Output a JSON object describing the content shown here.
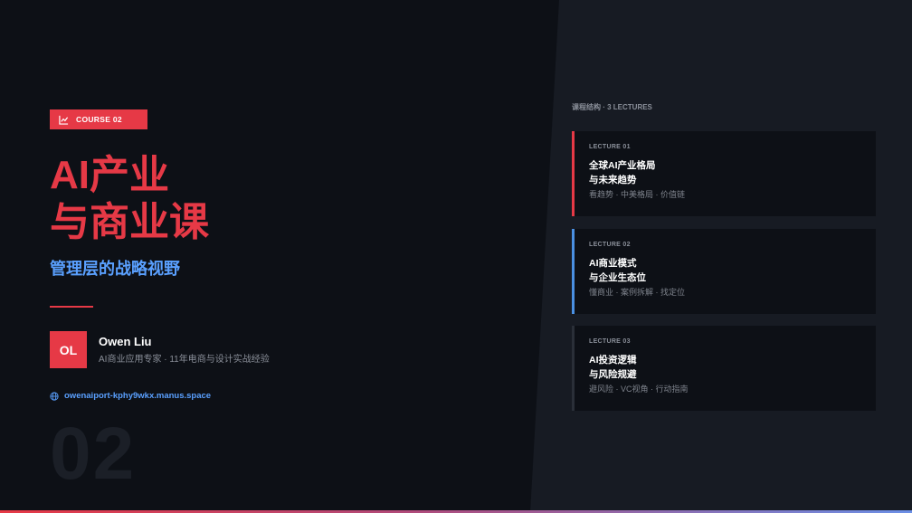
{
  "badge": {
    "label": "COURSE 02",
    "icon": "line-chart-icon"
  },
  "title": {
    "line1": "AI产业",
    "line2": "与商业课"
  },
  "subtitle": "管理层的战略视野",
  "author": {
    "initials": "OL",
    "name": "Owen Liu",
    "description": "AI商业应用专家 · 11年电商与设计实战经验"
  },
  "website": {
    "url": "owenaiport-kphy9wkx.manus.space",
    "icon": "globe-icon"
  },
  "big_number": "02",
  "structure_label": "课程结构 · 3 LECTURES",
  "lectures": [
    {
      "number": "LECTURE 01",
      "title_line1": "全球AI产业格局",
      "title_line2": "与未来趋势",
      "tags": "看趋势 · 中美格局 · 价值链",
      "accent": "#e63946"
    },
    {
      "number": "LECTURE 02",
      "title_line1": "AI商业模式",
      "title_line2": "与企业生态位",
      "tags": "懂商业 · 案例拆解 · 找定位",
      "accent": "#4a90e2"
    },
    {
      "number": "LECTURE 03",
      "title_line1": "AI投资逻辑",
      "title_line2": "与风险规避",
      "tags": "避风险 · VC视角 · 行动指南",
      "accent": "#2a2f38"
    }
  ],
  "colors": {
    "primary": "#e63946",
    "accent_blue": "#5aa0ff",
    "bg_left": "#0d1016",
    "bg_right": "#171b23"
  }
}
